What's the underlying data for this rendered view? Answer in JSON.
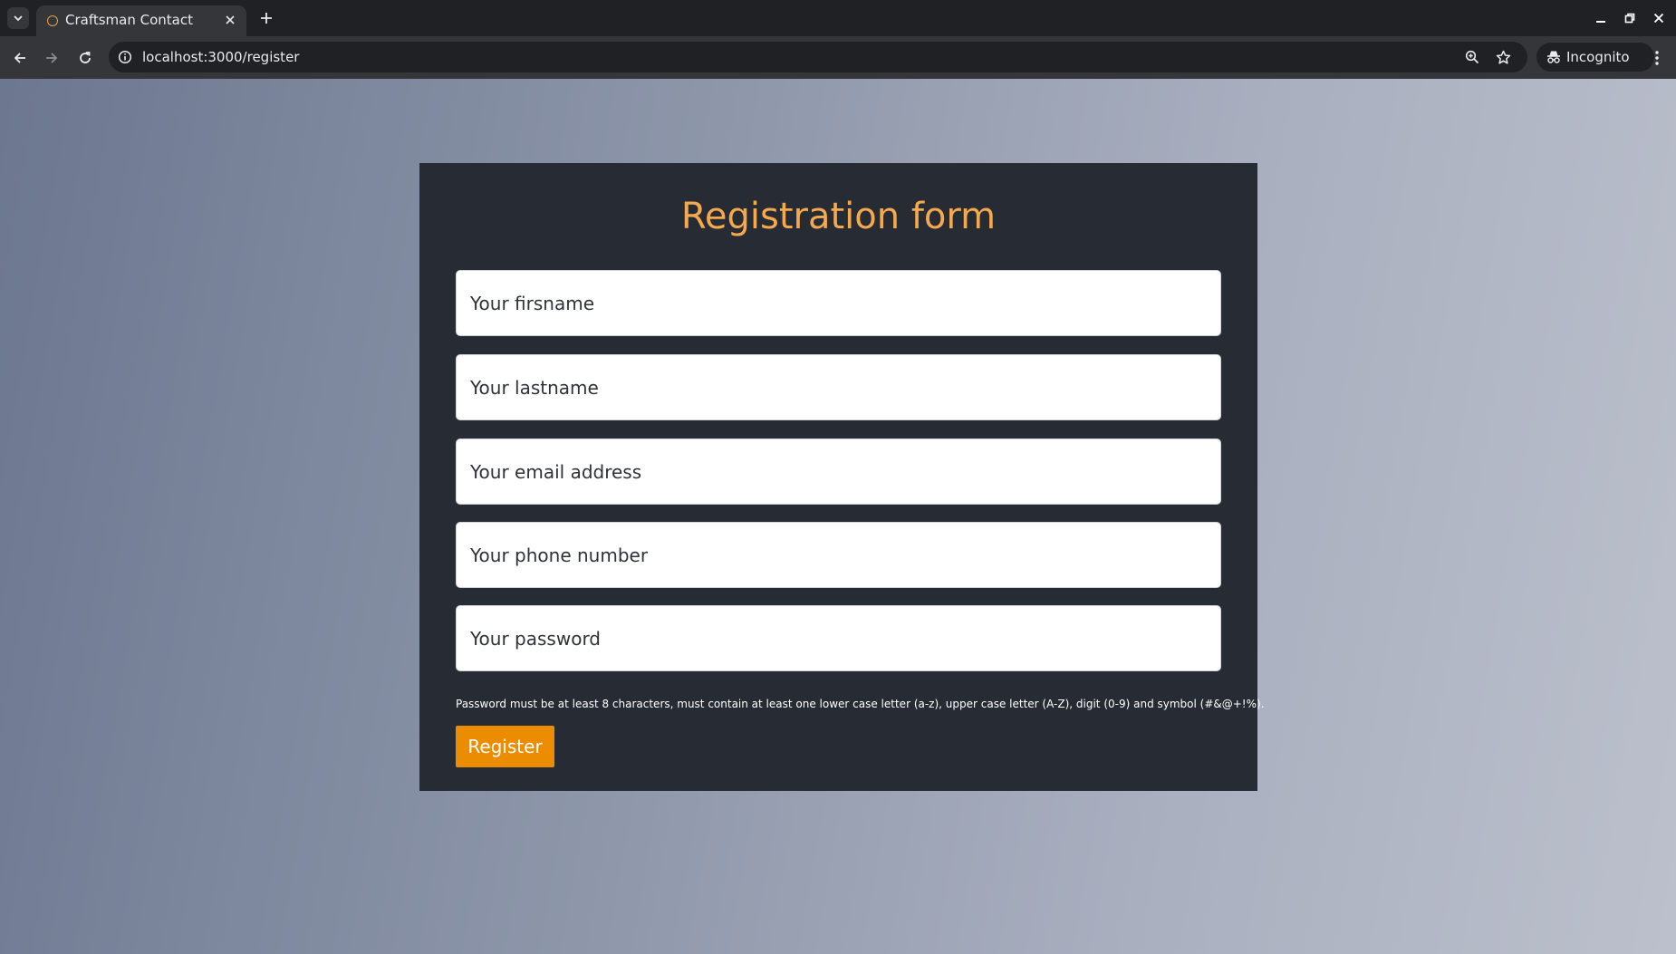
{
  "browser": {
    "tab_title": "Craftsman Contact",
    "url": "localhost:3000/register",
    "incognito_label": "Incognito",
    "accent_color": "#e4a33a"
  },
  "form": {
    "title": "Registration form",
    "fields": {
      "firstname": {
        "placeholder": "Your firsname",
        "value": ""
      },
      "lastname": {
        "placeholder": "Your lastname",
        "value": ""
      },
      "email": {
        "placeholder": "Your email address",
        "value": ""
      },
      "phone": {
        "placeholder": "Your phone number",
        "value": ""
      },
      "password": {
        "placeholder": "Your password",
        "value": ""
      }
    },
    "password_hint": "Password must be at least 8 characters, must contain at least one lower case letter (a-z), upper case letter (A-Z), digit (0-9) and symbol (#&@+!%).",
    "submit_label": "Register",
    "colors": {
      "title": "#f4a94e",
      "button": "#ec8c00",
      "card": "#272b34"
    }
  }
}
